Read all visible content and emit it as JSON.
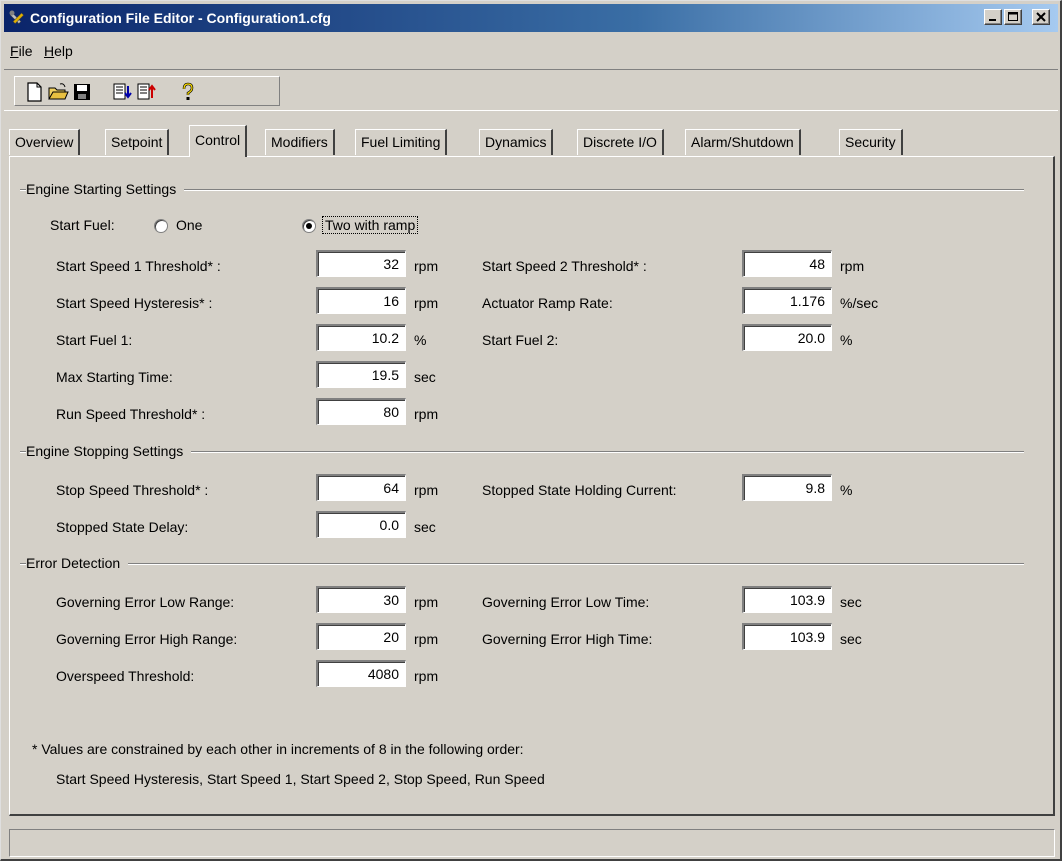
{
  "window": {
    "title": "Configuration File Editor - Configuration1.cfg",
    "min_label": "_",
    "max_label": "□",
    "close_label": "×"
  },
  "menu": {
    "file_key": "F",
    "file_rest": "ile",
    "help_key": "H",
    "help_rest": "elp"
  },
  "toolbar": {
    "icons": [
      "new-file-icon",
      "open-folder-icon",
      "save-icon",
      "download-config-icon",
      "upload-config-icon",
      "help-icon"
    ]
  },
  "tabs": [
    {
      "label": "Overview"
    },
    {
      "label": "Setpoint"
    },
    {
      "label": "Control",
      "active": true
    },
    {
      "label": "Modifiers"
    },
    {
      "label": "Fuel Limiting"
    },
    {
      "label": "Dynamics"
    },
    {
      "label": "Discrete I/O"
    },
    {
      "label": "Alarm/Shutdown"
    },
    {
      "label": "Security"
    }
  ],
  "starting": {
    "title": "Engine Starting Settings",
    "start_fuel_label": "Start Fuel:",
    "option_one": "One",
    "option_two": "Two with ramp",
    "selected": "Two with ramp",
    "speed1_label": "Start Speed 1 Threshold* :",
    "speed1_value": "32",
    "speed1_unit": "rpm",
    "speed2_label": "Start Speed 2 Threshold* :",
    "speed2_value": "48",
    "speed2_unit": "rpm",
    "hysteresis_label": "Start Speed Hysteresis* :",
    "hysteresis_value": "16",
    "hysteresis_unit": "rpm",
    "ramp_label": "Actuator Ramp Rate:",
    "ramp_value": "1.176",
    "ramp_unit": "%/sec",
    "fuel1_label": "Start Fuel 1:",
    "fuel1_value": "10.2",
    "fuel1_unit": "%",
    "fuel2_label": "Start Fuel 2:",
    "fuel2_value": "20.0",
    "fuel2_unit": "%",
    "max_time_label": "Max Starting Time:",
    "max_time_value": "19.5",
    "max_time_unit": "sec",
    "run_label": "Run Speed Threshold* :",
    "run_value": "80",
    "run_unit": "rpm"
  },
  "stopping": {
    "title": "Engine Stopping Settings",
    "stop_label": "Stop Speed Threshold* :",
    "stop_value": "64",
    "stop_unit": "rpm",
    "holding_label": "Stopped State Holding Current:",
    "holding_value": "9.8",
    "holding_unit": "%",
    "delay_label": "Stopped State Delay:",
    "delay_value": "0.0",
    "delay_unit": "sec"
  },
  "error": {
    "title": "Error Detection",
    "low_range_label": "Governing Error Low Range:",
    "low_range_value": "30",
    "low_range_unit": "rpm",
    "low_time_label": "Governing Error Low Time:",
    "low_time_value": "103.9",
    "low_time_unit": "sec",
    "high_range_label": "Governing Error High Range:",
    "high_range_value": "20",
    "high_range_unit": "rpm",
    "high_time_label": "Governing Error High Time:",
    "high_time_value": "103.9",
    "high_time_unit": "sec",
    "overspeed_label": "Overspeed Threshold:",
    "overspeed_value": "4080",
    "overspeed_unit": "rpm"
  },
  "note": {
    "line1": "* Values are constrained by each other in increments of 8 in the following order:",
    "line2": "Start Speed Hysteresis, Start Speed 1, Start Speed 2, Stop Speed, Run Speed"
  },
  "status": {
    "text": ""
  }
}
